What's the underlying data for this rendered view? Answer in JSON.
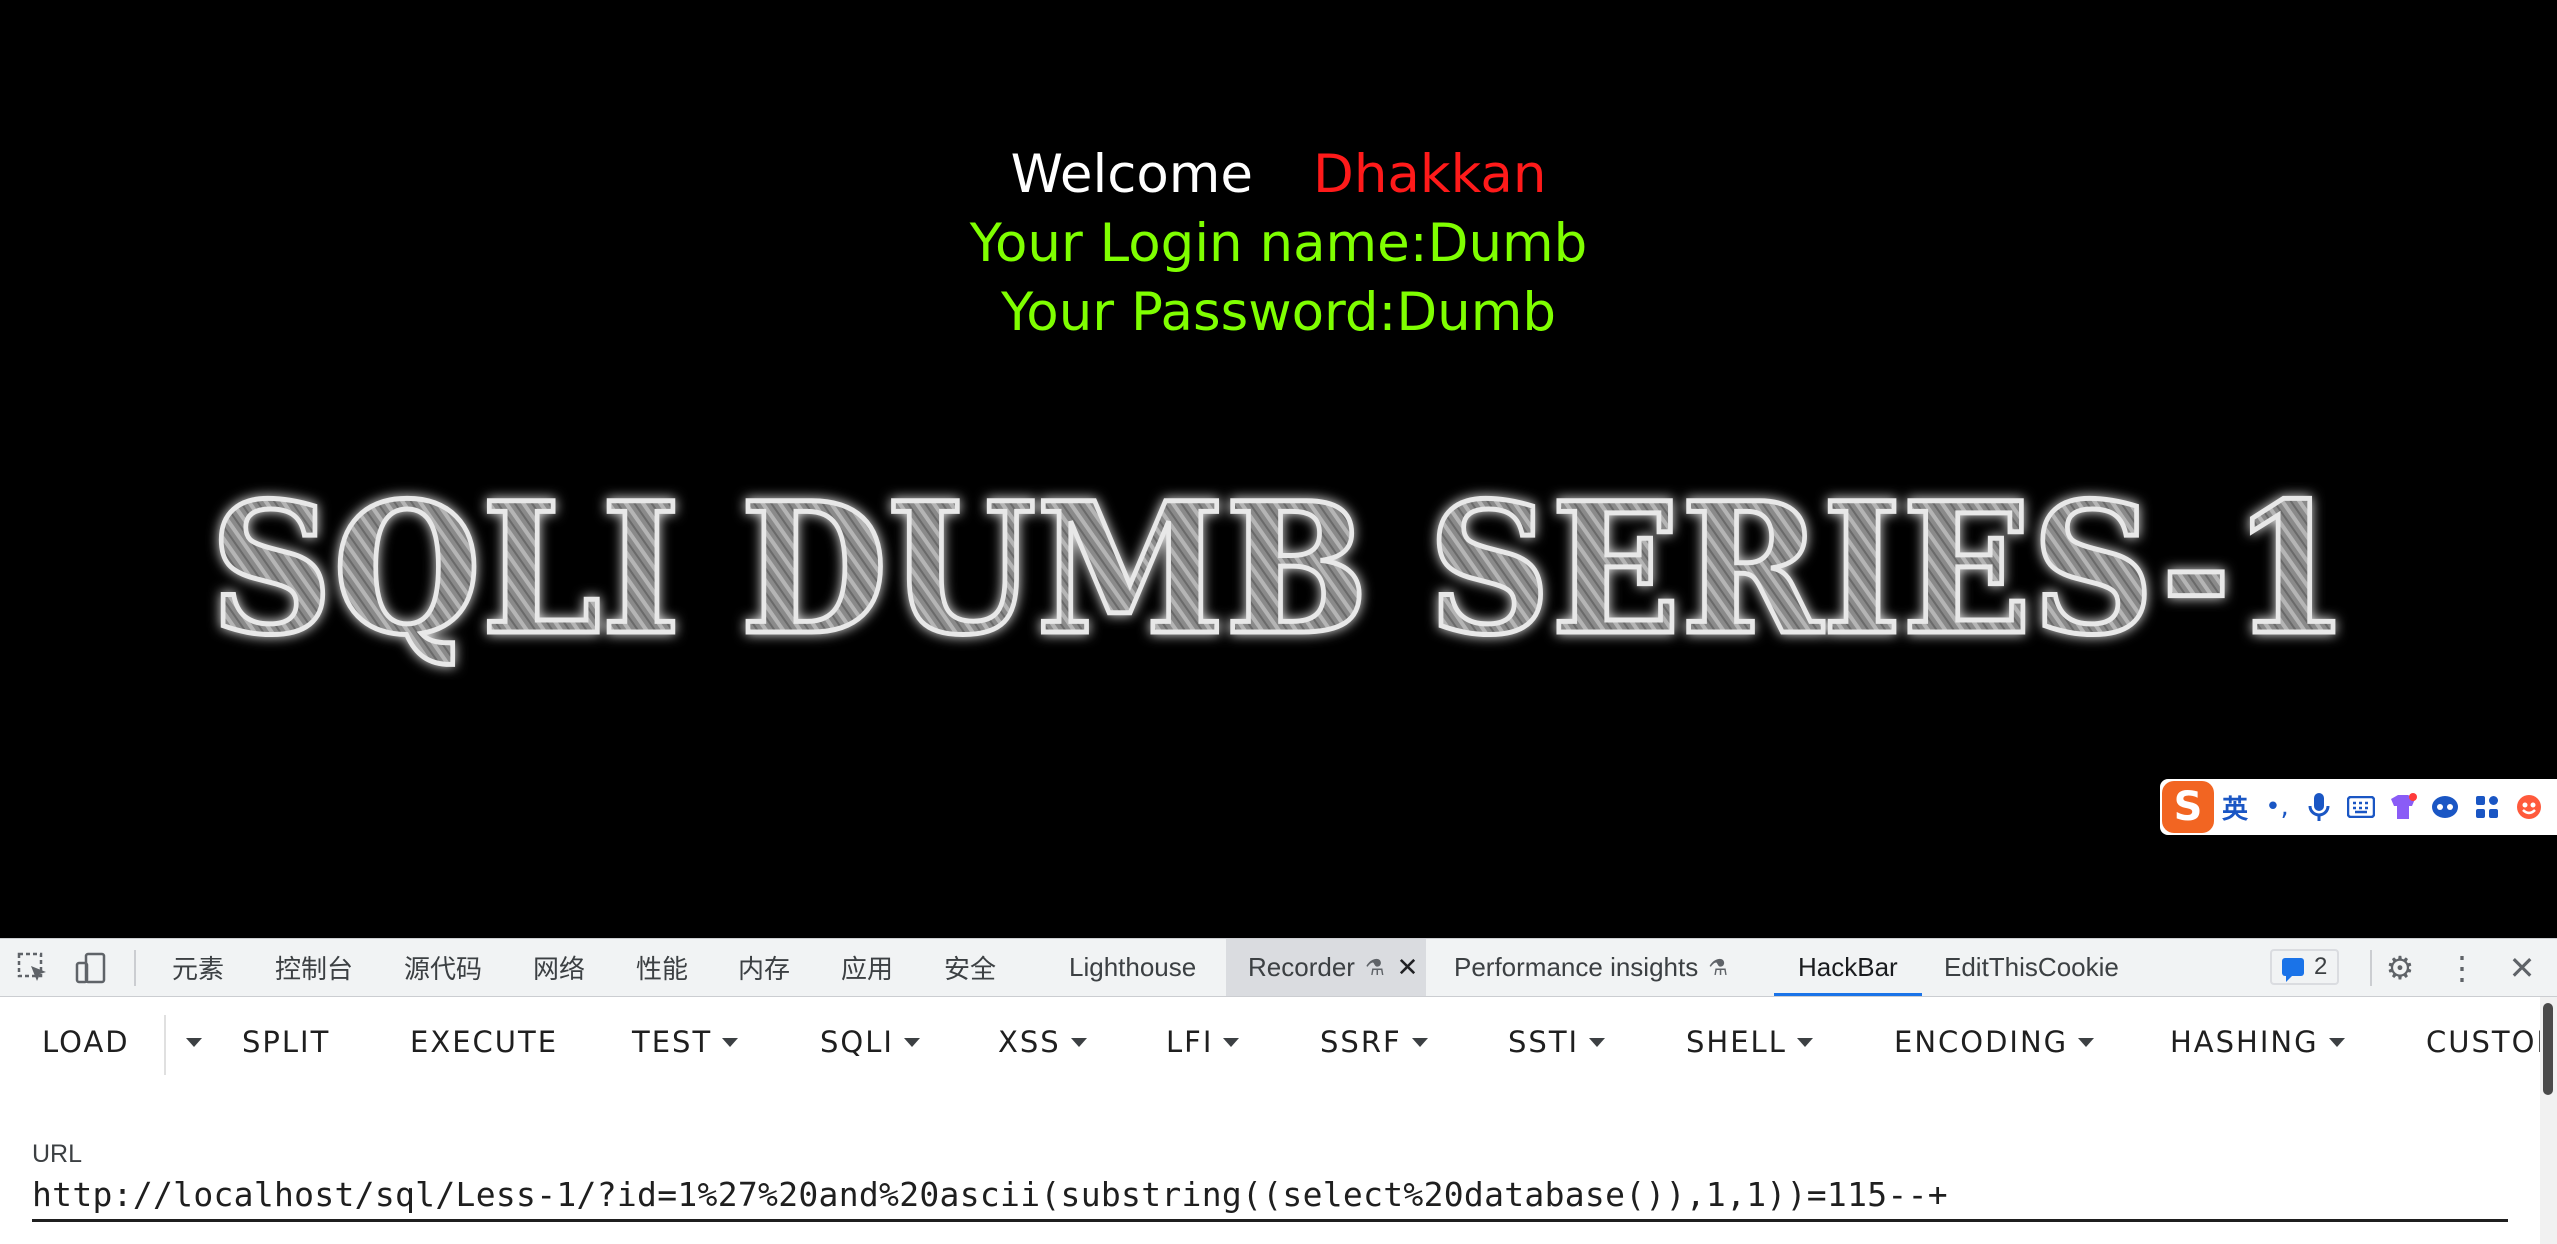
{
  "page": {
    "welcome_label": "Welcome",
    "welcome_name": "Dhakkan",
    "login_line": "Your Login name:Dumb",
    "password_line": "Your Password:Dumb",
    "banner_text": "SQLI DUMB SERIES-1"
  },
  "ime_toolbar": {
    "logo": "S",
    "language": "英",
    "items": [
      "punctuation-icon",
      "microphone-icon",
      "keyboard-icon",
      "skin-icon",
      "assistant-icon",
      "apps-icon",
      "emoji-icon"
    ]
  },
  "devtools": {
    "tabs": [
      "元素",
      "控制台",
      "源代码",
      "网络",
      "性能",
      "内存",
      "应用",
      "安全",
      "Lighthouse",
      "Recorder",
      "Performance insights",
      "HackBar",
      "EditThisCookie"
    ],
    "issues_count": "2",
    "selected_tab": "HackBar",
    "accent": "#1a73e8"
  },
  "hackbar": {
    "buttons": [
      "LOAD",
      "SPLIT",
      "EXECUTE",
      "TEST",
      "SQLI",
      "XSS",
      "LFI",
      "SSRF",
      "SSTI",
      "SHELL",
      "ENCODING",
      "HASHING",
      "CUSTOM"
    ],
    "url_label": "URL",
    "url_value": "http://localhost/sql/Less-1/?id=1%27%20and%20ascii(substring((select%20database()),1,1))=115--+"
  }
}
